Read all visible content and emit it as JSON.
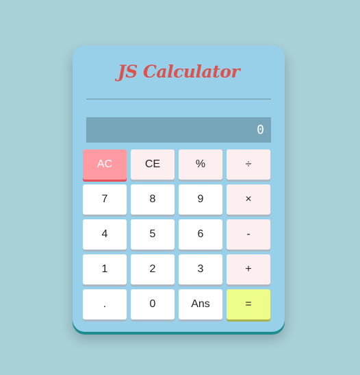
{
  "app": {
    "title": "JS Calculator"
  },
  "display": {
    "value": "0"
  },
  "keys": [
    {
      "label": "AC",
      "name": "all-clear-button",
      "kind": "clear"
    },
    {
      "label": "CE",
      "name": "clear-entry-button",
      "kind": "op"
    },
    {
      "label": "%",
      "name": "percent-button",
      "kind": "op"
    },
    {
      "label": "÷",
      "name": "divide-button",
      "kind": "op"
    },
    {
      "label": "7",
      "name": "digit-7-button",
      "kind": "digit"
    },
    {
      "label": "8",
      "name": "digit-8-button",
      "kind": "digit"
    },
    {
      "label": "9",
      "name": "digit-9-button",
      "kind": "digit"
    },
    {
      "label": "×",
      "name": "multiply-button",
      "kind": "op"
    },
    {
      "label": "4",
      "name": "digit-4-button",
      "kind": "digit"
    },
    {
      "label": "5",
      "name": "digit-5-button",
      "kind": "digit"
    },
    {
      "label": "6",
      "name": "digit-6-button",
      "kind": "digit"
    },
    {
      "label": "-",
      "name": "subtract-button",
      "kind": "op"
    },
    {
      "label": "1",
      "name": "digit-1-button",
      "kind": "digit"
    },
    {
      "label": "2",
      "name": "digit-2-button",
      "kind": "digit"
    },
    {
      "label": "3",
      "name": "digit-3-button",
      "kind": "digit"
    },
    {
      "label": "+",
      "name": "add-button",
      "kind": "op"
    },
    {
      "label": ".",
      "name": "decimal-point-button",
      "kind": "digit"
    },
    {
      "label": "0",
      "name": "digit-0-button",
      "kind": "digit"
    },
    {
      "label": "Ans",
      "name": "answer-button",
      "kind": "digit"
    },
    {
      "label": "=",
      "name": "equals-button",
      "kind": "equals"
    }
  ],
  "colors": {
    "background": "#a8d0d6",
    "calculator_body": "#98d0ea",
    "title": "#d9534f",
    "display": "#77a6bb",
    "clear_key": "#ff9aa2",
    "operator_key": "#fdeef0",
    "equals_key": "#eefc89"
  }
}
